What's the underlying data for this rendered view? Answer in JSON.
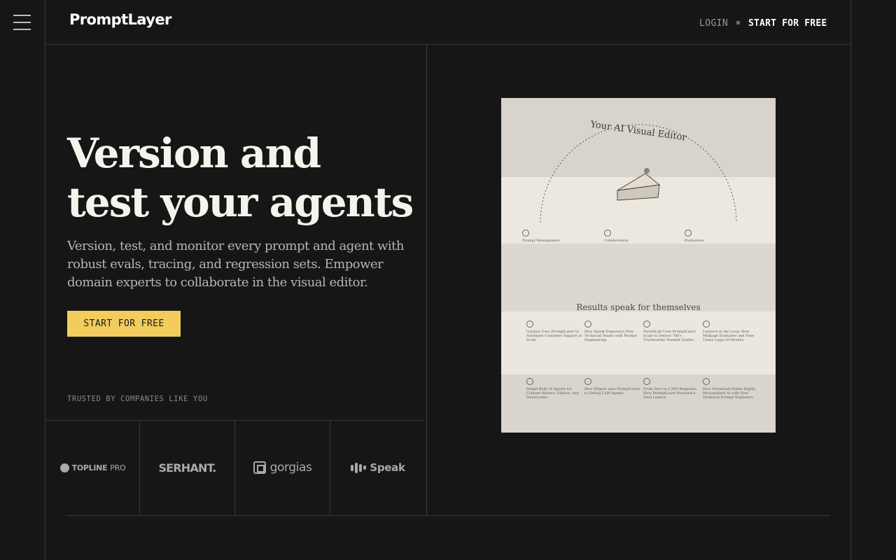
{
  "header": {
    "logo": "PromptLayer",
    "nav": {
      "login": "LOGIN",
      "start": "START FOR FREE"
    }
  },
  "hero": {
    "title_line1": "Version and",
    "title_line2": "test your agents",
    "description": "Version, test, and monitor every prompt and agent with robust evals, tracing, and regression sets. Empower domain experts to collaborate in the visual editor.",
    "cta": "START FOR FREE"
  },
  "trusted": {
    "label": "TRUSTED BY COMPANIES LIKE YOU",
    "logos": [
      {
        "name": "TOPLINE",
        "suffix": "PRO"
      },
      {
        "name": "SERHANT."
      },
      {
        "name": "gorgias"
      },
      {
        "name": "Speak"
      }
    ]
  },
  "poster": {
    "title": "Your AI Visual Editor",
    "features": [
      "Prompt Management",
      "Collaboration",
      "Evaluation"
    ],
    "results_heading": "Results speak for themselves",
    "case_studies": [
      "Gorgias Uses PromptLayer to Automate Customer Support at Scale",
      "How Speak Empowers Non-Technical Teams with Prompt Engineering",
      "ParentLab Uses PromptLayer Scale to Deliver 700+ Trustworthy Student Guides",
      "Lawyers in the Loop: How Midpage Evaluates and Fine-Tunes Legal AI Models",
      "Magid Built AI Agents for Content Writers, Editors, and Newsrooms",
      "How Ellipsis uses PromptLayer to Debug LLM Agents",
      "From Zero to 1,500 Requests: How PromptLayer Powered a Viral Launch",
      "How ParentLab Builds Highly Personalized AI with Non-Technical Prompt Engineers"
    ]
  },
  "colors": {
    "background": "#161616",
    "accent": "#f2cd5e",
    "paper": "#e6e2d9"
  },
  "icons": {
    "menu": "hamburger-icon"
  }
}
